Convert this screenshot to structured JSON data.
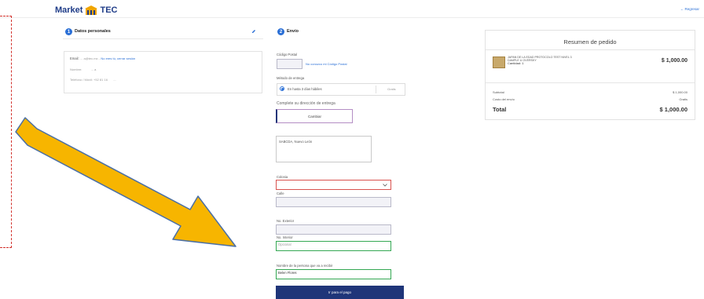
{
  "header": {
    "logo_text": "Market",
    "logo_brand": "TEC",
    "back_label": "← Regresar"
  },
  "personal": {
    "step": "1",
    "title": "Datos personales",
    "email_label": "Email:",
    "email_value": "... a@tec.mx -",
    "email_link": "No eres tú, cerrar sesión",
    "name_label": "Nombre:",
    "name_value": "... a",
    "phone_label": "Teléfono / Móvil: +52 81 16",
    "phone_value": "..."
  },
  "shipping": {
    "step": "2",
    "title": "Envío",
    "postal_label": "Código Postal",
    "postal_link": "No conozco mi Código Postal",
    "method_label": "Método de entrega",
    "method_option": "En hasta 3 días hábiles",
    "method_price": "Gratis",
    "address_heading": "Complete su dirección de entrega",
    "cambiar_label": "Cambiar",
    "state_text": "SABCDA, Nuevo León",
    "colonia_label": "Colonia",
    "calle_label": "Calle",
    "ext_label": "No. Exterior",
    "int_label": "No. Interior",
    "int_placeholder": "Opcional",
    "receiver_label": "Nombre de la persona que va a recibir",
    "receiver_value": "Belen Flores",
    "pay_button": "Ir para el pago"
  },
  "summary": {
    "title": "Resumen de pedido",
    "product_name": "JAPAN DE LA EDAD PROTOCOLO TEST NIVEL 3",
    "product_sub": "DAMPLE U OVERSKY",
    "quantity": "Cantidad: 1",
    "product_price": "$ 1,000.00",
    "subtotal_label": "Subtotal",
    "subtotal_value": "$ 1,000.00",
    "shipping_label": "Costo del envío",
    "shipping_value": "Gratis",
    "total_label": "Total",
    "total_value": "$ 1,000.00"
  },
  "colors": {
    "brand": "#1f3c88",
    "accent": "#2a6fd6",
    "arrow": "#f7b500",
    "pay_button": "#1f3579"
  }
}
